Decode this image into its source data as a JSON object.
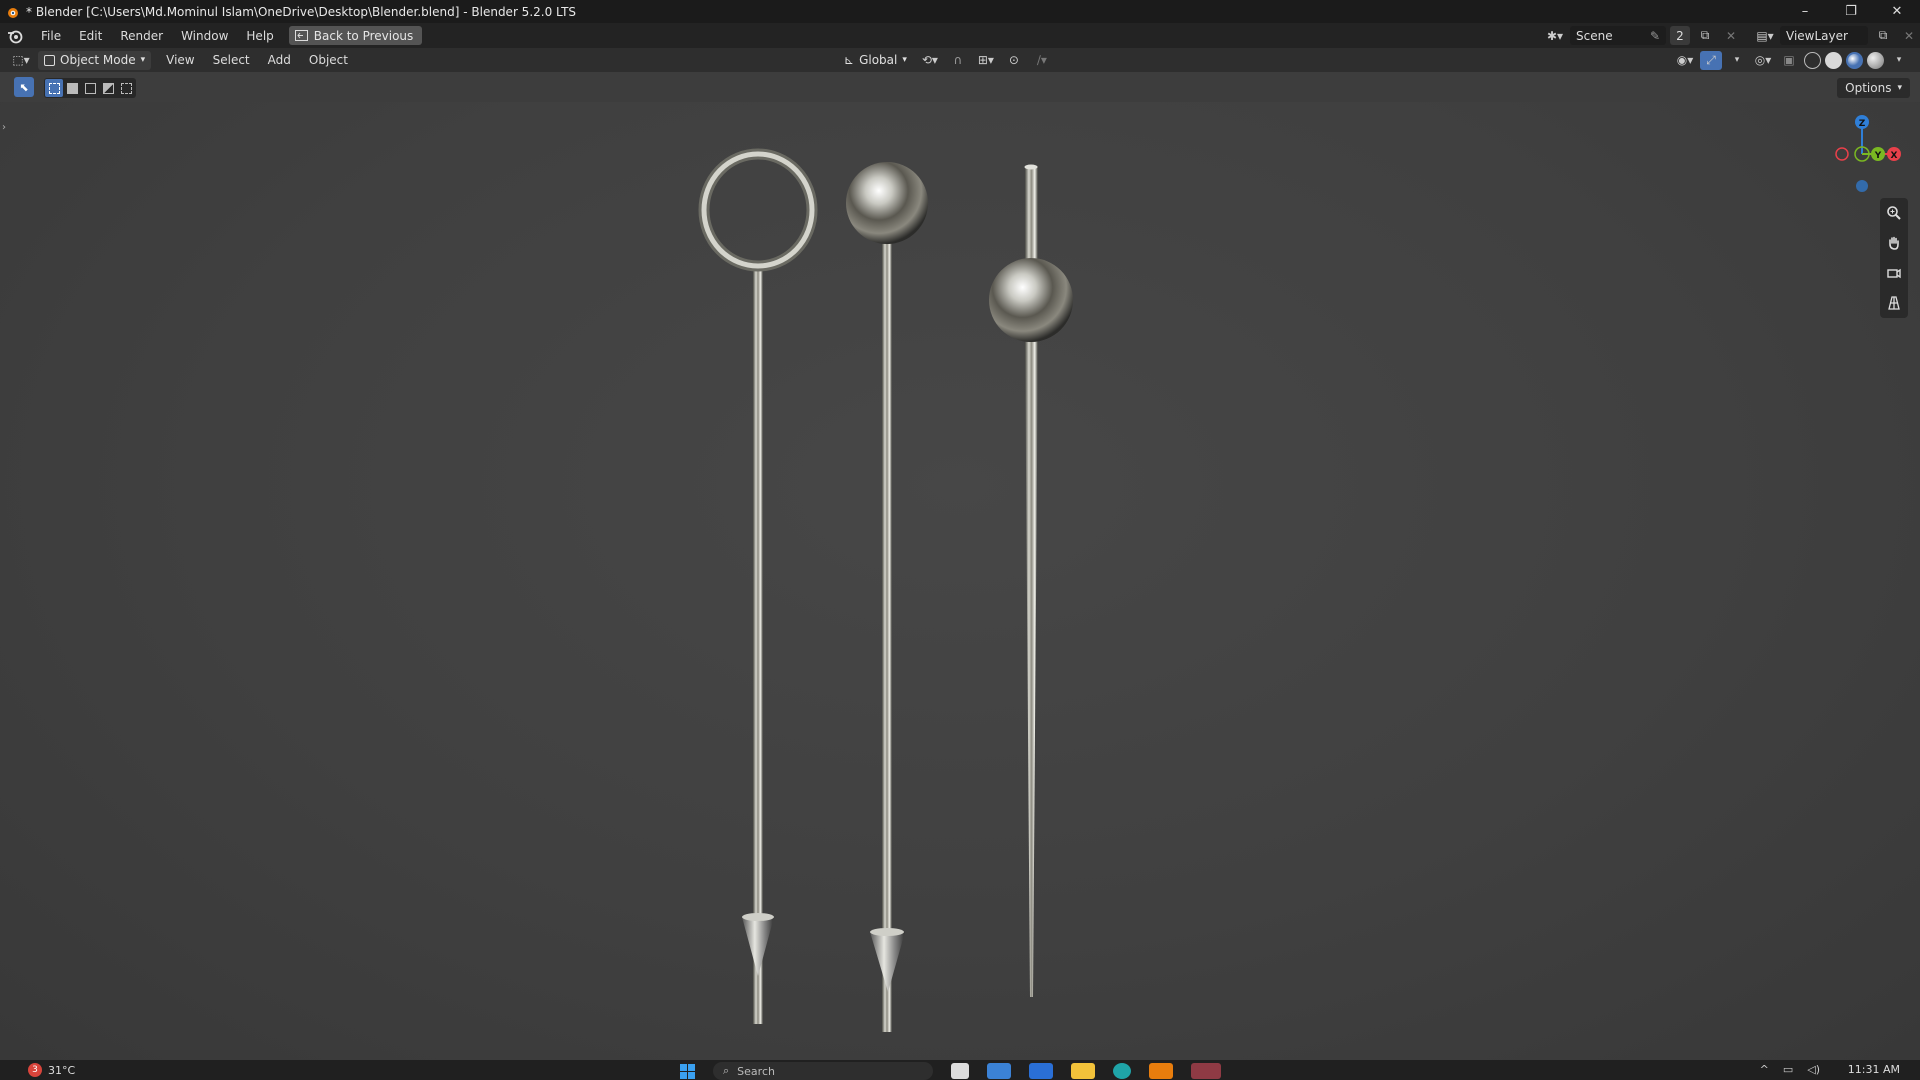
{
  "window": {
    "title": "* Blender [C:\\Users\\Md.Mominul Islam\\OneDrive\\Desktop\\Blender.blend] - Blender 5.2.0 LTS",
    "controls": [
      "–",
      "❐",
      "✕"
    ]
  },
  "menubar": {
    "items": [
      "File",
      "Edit",
      "Render",
      "Window",
      "Help"
    ],
    "back_button": "Back to Previous",
    "scene_name": "Scene",
    "scene_users": "2",
    "view_layer": "ViewLayer"
  },
  "header": {
    "mode": "Object Mode",
    "menus": [
      "View",
      "Select",
      "Add",
      "Object"
    ],
    "orientation": "Global"
  },
  "toolrow": {
    "options_label": "Options"
  },
  "gizmo": {
    "axes": [
      "Z",
      "Y",
      "X"
    ],
    "colors": {
      "x": "#e8404a",
      "y": "#7ab822",
      "z": "#2f7fd8"
    }
  },
  "taskbar": {
    "weather_badge": "3",
    "temperature": "31°C",
    "search_placeholder": "Search",
    "clock": "11:31 AM"
  },
  "colors": {
    "selected_tool": "#4772b3",
    "viewport_bg": "#404040"
  }
}
